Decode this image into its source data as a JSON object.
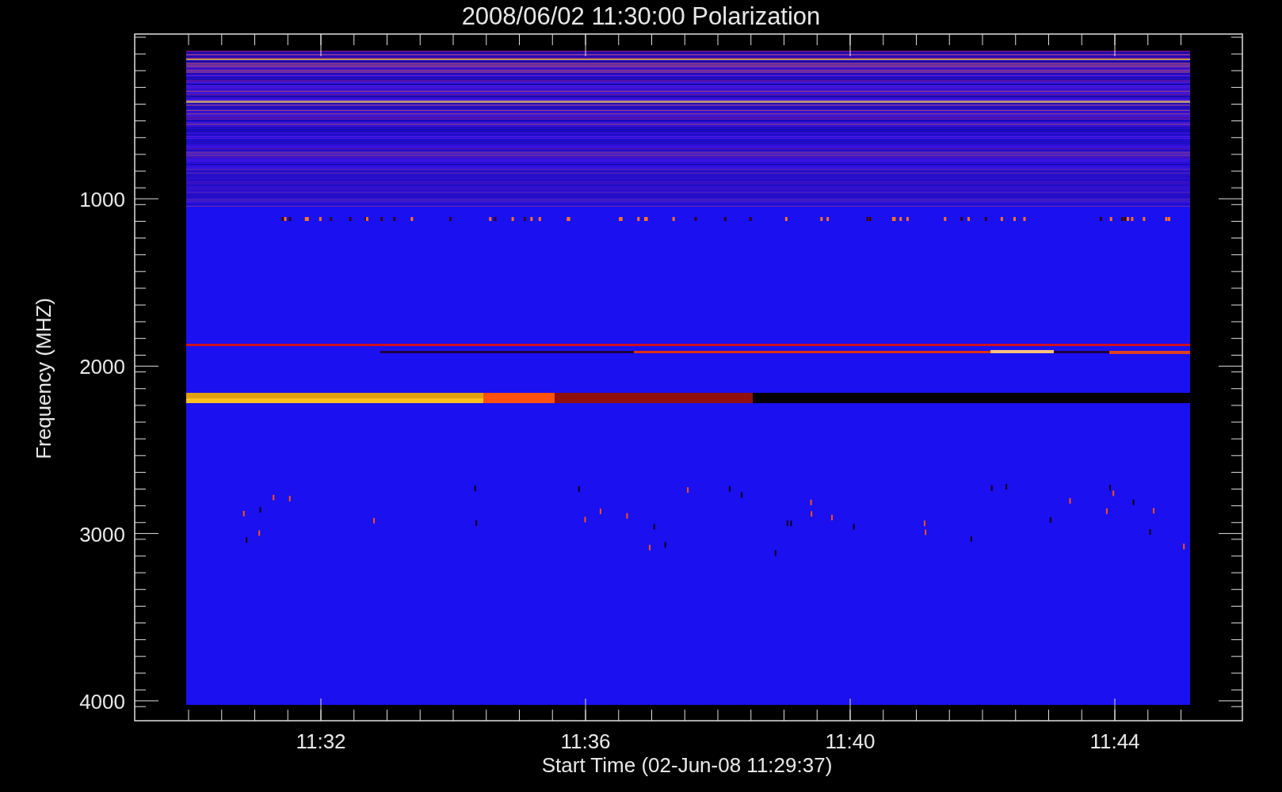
{
  "title": "2008/06/02 11:30:00 Polarization",
  "y_axis": {
    "label": "Frequency (MHZ)",
    "ticks": [
      "1000",
      "2000",
      "3000",
      "4000"
    ]
  },
  "x_axis": {
    "label": "Start Time (02-Jun-08 11:29:37)",
    "ticks": [
      "11:32",
      "11:36",
      "11:40",
      "11:44"
    ]
  }
}
